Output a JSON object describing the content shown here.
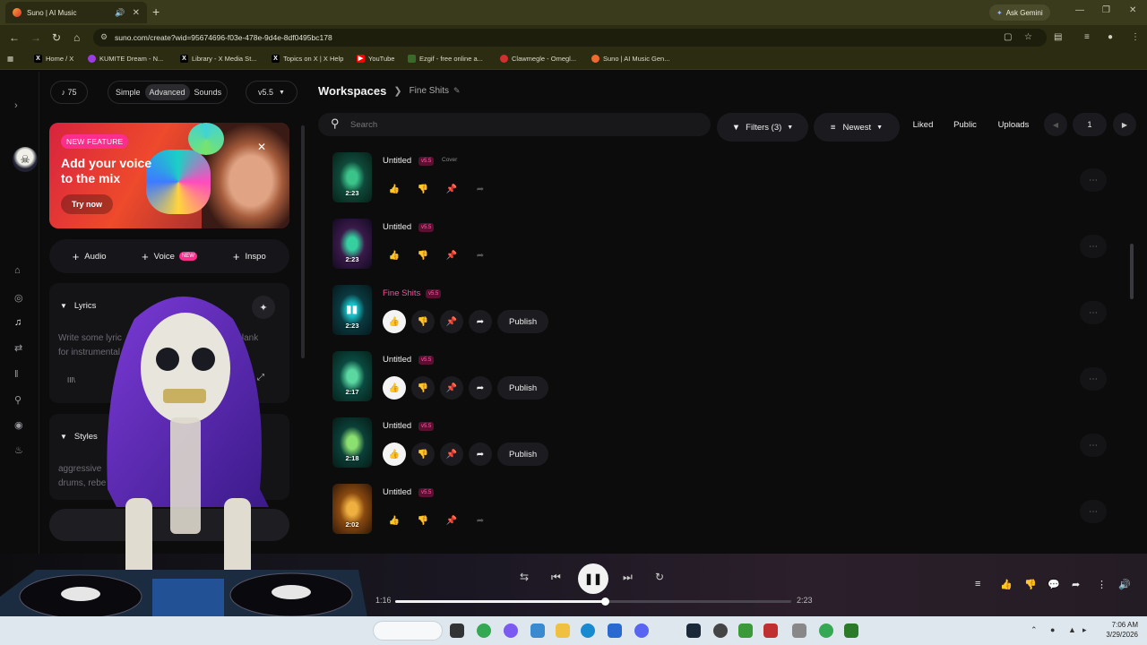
{
  "browser": {
    "tab_title": "Suno | AI Music",
    "new_tab": "+",
    "gemini_label": "Ask Gemini",
    "url": "suno.com/create?wid=95674696-f03e-478e-9d4e-8df0495bc178",
    "bookmarks": [
      {
        "label": "Home / X",
        "icon": "x-icon",
        "color": "#000000"
      },
      {
        "label": "KUMITE Dream - N...",
        "icon": "kumite-icon",
        "color": "#9b3de0"
      },
      {
        "label": "Library - X Media St...",
        "icon": "x-icon",
        "color": "#000000"
      },
      {
        "label": "Topics on X | X Help",
        "icon": "x-icon",
        "color": "#000000"
      },
      {
        "label": "YouTube",
        "icon": "youtube-icon",
        "color": "#ff0000"
      },
      {
        "label": "Ezgif - free online a...",
        "icon": "ezgif-icon",
        "color": "#3a6a2a"
      },
      {
        "label": "Clawmegle - Omegl...",
        "icon": "claw-icon",
        "color": "#d03030"
      },
      {
        "label": "Suno | AI Music Gen...",
        "icon": "suno-icon",
        "color": "#f06a30"
      }
    ]
  },
  "left": {
    "credits": "♪ 75",
    "modes": [
      "Simple",
      "Advanced",
      "Sounds"
    ],
    "active_mode": "Advanced",
    "version": "v5.5",
    "promo": {
      "badge": "NEW FEATURE",
      "title": "Add your voice to the mix",
      "cta": "Try now"
    },
    "add_buttons": [
      {
        "label": "Audio"
      },
      {
        "label": "Voice",
        "tag": "NEW"
      },
      {
        "label": "Inspo"
      }
    ],
    "lyrics": {
      "header": "Lyrics",
      "placeholder_a": "Write some lyric",
      "placeholder_b": "ve blank",
      "placeholder_c": "for instrumental",
      "counter": "III\\"
    },
    "styles": {
      "header": "Styles",
      "text_a": "aggressive",
      "text_b": "drums, rebe",
      "text_c": "llig"
    }
  },
  "main": {
    "breadcrumb_root": "Workspaces",
    "breadcrumb_current": "Fine Shits",
    "search_placeholder": "Search",
    "filters_label": "Filters (3)",
    "sort_label": "Newest",
    "liked_label": "Liked",
    "public_label": "Public",
    "uploads_label": "Uploads",
    "page_number": "1",
    "songs": [
      {
        "title": "Untitled",
        "version": "v5.5",
        "extra_tag": "Cover",
        "duration": "2:23",
        "highlight": false,
        "actions_active": false,
        "publish": "",
        "colors": [
          "#0f4a3a",
          "#3bc48a",
          "#072018"
        ]
      },
      {
        "title": "Untitled",
        "version": "v5.5",
        "extra_tag": "",
        "duration": "2:23",
        "highlight": false,
        "actions_active": false,
        "publish": "",
        "colors": [
          "#3a1a4a",
          "#36d0a0",
          "#120a20"
        ]
      },
      {
        "title": "Fine Shits",
        "version": "v5.5",
        "extra_tag": "",
        "duration": "2:23",
        "highlight": true,
        "actions_active": true,
        "publish": "Publish",
        "colors": [
          "#0a3a40",
          "#1ac0c8",
          "#06181c"
        ]
      },
      {
        "title": "Untitled",
        "version": "v5.5",
        "extra_tag": "",
        "duration": "2:17",
        "highlight": false,
        "actions_active": true,
        "publish": "Publish",
        "colors": [
          "#0a4a40",
          "#5ad8a0",
          "#06201a"
        ]
      },
      {
        "title": "Untitled",
        "version": "v5.5",
        "extra_tag": "",
        "duration": "2:18",
        "highlight": false,
        "actions_active": true,
        "publish": "Publish",
        "colors": [
          "#0a4038",
          "#8ce070",
          "#061a16"
        ]
      },
      {
        "title": "Untitled",
        "version": "v5.5",
        "extra_tag": "",
        "duration": "2:02",
        "highlight": false,
        "actions_active": false,
        "publish": "",
        "colors": [
          "#8a4a10",
          "#f0b040",
          "#301808"
        ]
      }
    ]
  },
  "player": {
    "current_time": "1:16",
    "total_time": "2:23",
    "progress": 0.53
  },
  "taskbar": {
    "time": "7:06 AM",
    "date": "3/29/2026"
  }
}
